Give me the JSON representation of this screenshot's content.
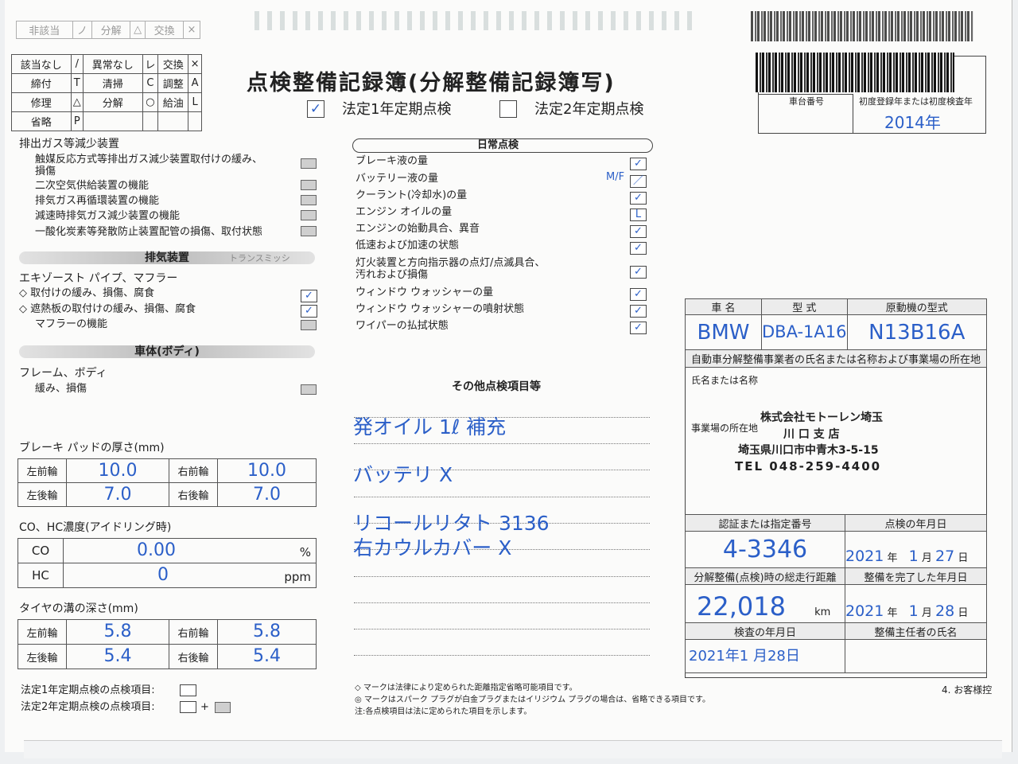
{
  "header": {
    "top_legend": [
      "非該当",
      "ノ",
      "分解",
      "△",
      "交換",
      "×"
    ],
    "legend": [
      [
        "該当なし",
        "/",
        "異常なし",
        "レ",
        "交換",
        "×"
      ],
      [
        "締付",
        "T",
        "清掃",
        "C",
        "調整",
        "A"
      ],
      [
        "修理",
        "△",
        "分解",
        "○",
        "給油",
        "L"
      ],
      [
        "省略",
        "P",
        "",
        "",
        "",
        ""
      ]
    ],
    "title": "点検整備記録簿(分解整備記録簿写)",
    "option1": "法定1年定期点検",
    "option2": "法定2年定期点検",
    "option1_mark": "✓",
    "reg_label": "車台番号",
    "first_reg_label": "初度登録年または初度検査年",
    "first_reg_value": "2014年"
  },
  "emission": {
    "title": "排出ガス等減少装置",
    "items": [
      "触媒反応方式等排出ガス減少装置取付けの緩み、",
      "損傷",
      "二次空気供給装置の機能",
      "排気ガス再循環装置の機能",
      "減速時排気ガス減少装置の機能",
      "一酸化炭素等発散防止装置配管の損傷、取付状態"
    ]
  },
  "exhaust": {
    "band": "排気装置",
    "faint": "トランスミッシ",
    "title": "エキゾースト パイプ、マフラー",
    "items": [
      "◇ 取付けの緩み、損傷、腐食",
      "◇ 遮熱板の取付けの緩み、損傷、腐食",
      "マフラーの機能"
    ],
    "marks": [
      "✓",
      "✓"
    ]
  },
  "body_section": {
    "band": "車体(ボディ)",
    "title": "フレーム、ボディ",
    "item": "緩み、損傷"
  },
  "brake": {
    "title": "ブレーキ パッドの厚さ(mm)",
    "labels": [
      "左前輪",
      "右前輪",
      "左後輪",
      "右後輪"
    ],
    "values": [
      "10.0",
      "10.0",
      "7.0",
      "7.0"
    ]
  },
  "co_hc": {
    "title": "CO、HC濃度(アイドリング時)",
    "co_label": "CO",
    "co_value": "0.00",
    "co_unit": "%",
    "hc_label": "HC",
    "hc_value": "0",
    "hc_unit": "ppm"
  },
  "tire": {
    "title": "タイヤの溝の深さ(mm)",
    "labels": [
      "左前輪",
      "右前輪",
      "左後輪",
      "右後輪"
    ],
    "values": [
      "5.8",
      "5.8",
      "5.4",
      "5.4"
    ]
  },
  "footer": {
    "legal1": "法定1年定期点検の点検項目:",
    "legal2": "法定2年定期点検の点検項目:",
    "plus": "+",
    "notes": [
      "◇ マークは法律により定められた距離指定省略可能項目です。",
      "◎ マークはスパーク プラグが白金プラグまたはイリジウム プラグの場合は、省略できる項目です。",
      "注:各点検項目は法に定められた項目を示します。"
    ],
    "copy": "4. お客様控"
  },
  "daily": {
    "title": "日常点検",
    "items": [
      "ブレーキ液の量",
      "バッテリー液の量",
      "クーラント(冷却水)の量",
      "エンジン オイルの量",
      "エンジンの始動具合、異音",
      "低速および加速の状態",
      "灯火装置と方向指示器の点灯/点滅具合、",
      "汚れおよび損傷",
      "ウィンドウ ウォッシャーの量",
      "ウィンドウ ウォッシャーの噴射状態",
      "ワイパーの払拭状態"
    ],
    "marks": [
      "✓",
      "／",
      "✓",
      "L",
      "✓",
      "✓",
      "✓",
      "✓",
      "✓",
      "✓"
    ],
    "battery_note": "M/F"
  },
  "other": {
    "title": "その他点検項目等",
    "lines": [
      "発オイル 1ℓ 補充",
      "バッテリ X",
      "リコールリタト 3136",
      "右カウルカバー X"
    ]
  },
  "vehicle": {
    "h_name": "車 名",
    "h_type": "型 式",
    "h_engine": "原動機の型式",
    "name": "BMW",
    "type": "DBA-1A16",
    "engine": "N13B16A",
    "business_header": "自動車分解整備事業者の氏名または名称および事業場の所在地",
    "name_label": "氏名または名称",
    "location_label": "事業場の所在地",
    "company": "株式会社モトーレン埼玉",
    "branch": "川 口 支 店",
    "address": "埼玉県川口市中青木3-5-15",
    "tel": "TEL 048-259-4400",
    "cert_label": "認証または指定番号",
    "cert_value": "4-3346",
    "insp_date_label": "点検の年月日",
    "insp_year": "2021",
    "insp_month": "1",
    "insp_day": "27",
    "y": "年",
    "m": "月",
    "d": "日",
    "odo_label": "分解整備(点検)時の総走行距離",
    "odo_value": "22,018",
    "odo_unit": "km",
    "done_label": "整備を完了した年月日",
    "done_year": "2021",
    "done_month": "1",
    "done_day": "28",
    "exam_label": "検査の年月日",
    "exam_value": "2021年1 月28日",
    "chief_label": "整備主任者の氏名"
  }
}
